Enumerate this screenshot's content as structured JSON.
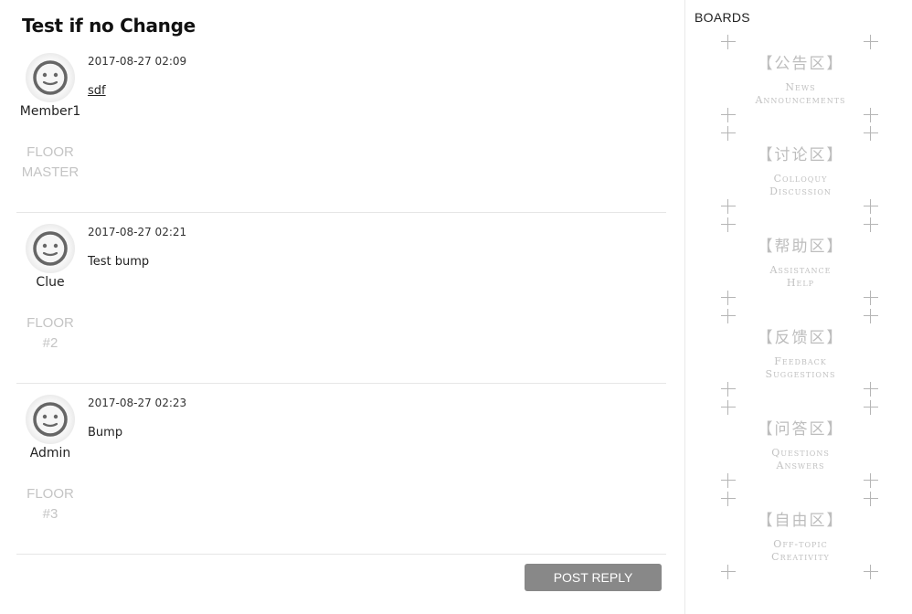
{
  "thread": {
    "title": "Test if no Change",
    "reply_label": "POST REPLY"
  },
  "posts": [
    {
      "username": "Member1",
      "floor_line1": "FLOOR",
      "floor_line2": "MASTER",
      "timestamp": "2017-08-27 02:09",
      "body": "sdf"
    },
    {
      "username": "Clue",
      "floor_line1": "FLOOR",
      "floor_line2": "#2",
      "timestamp": "2017-08-27 02:21",
      "body": "Test bump"
    },
    {
      "username": "Admin",
      "floor_line1": "FLOOR",
      "floor_line2": "#3",
      "timestamp": "2017-08-27 02:23",
      "body": "Bump"
    }
  ],
  "sidebar": {
    "title": "BOARDS",
    "boards": [
      {
        "cn": "【公告区】",
        "en1": "News",
        "en2": "Announcements"
      },
      {
        "cn": "【讨论区】",
        "en1": "Colloquy",
        "en2": "Discussion"
      },
      {
        "cn": "【帮助区】",
        "en1": "Assistance",
        "en2": "Help"
      },
      {
        "cn": "【反馈区】",
        "en1": "Feedback",
        "en2": "Suggestions"
      },
      {
        "cn": "【问答区】",
        "en1": "Questions",
        "en2": "Answers"
      },
      {
        "cn": "【自由区】",
        "en1": "Off-topic",
        "en2": "Creativity"
      }
    ]
  },
  "icons": {
    "avatar": "smiley-face-icon",
    "board_corner": "crosshair-tick-icon"
  },
  "colors": {
    "button_bg": "#888888",
    "muted_text": "#c4c4c4",
    "divider": "#e6e6e6"
  }
}
